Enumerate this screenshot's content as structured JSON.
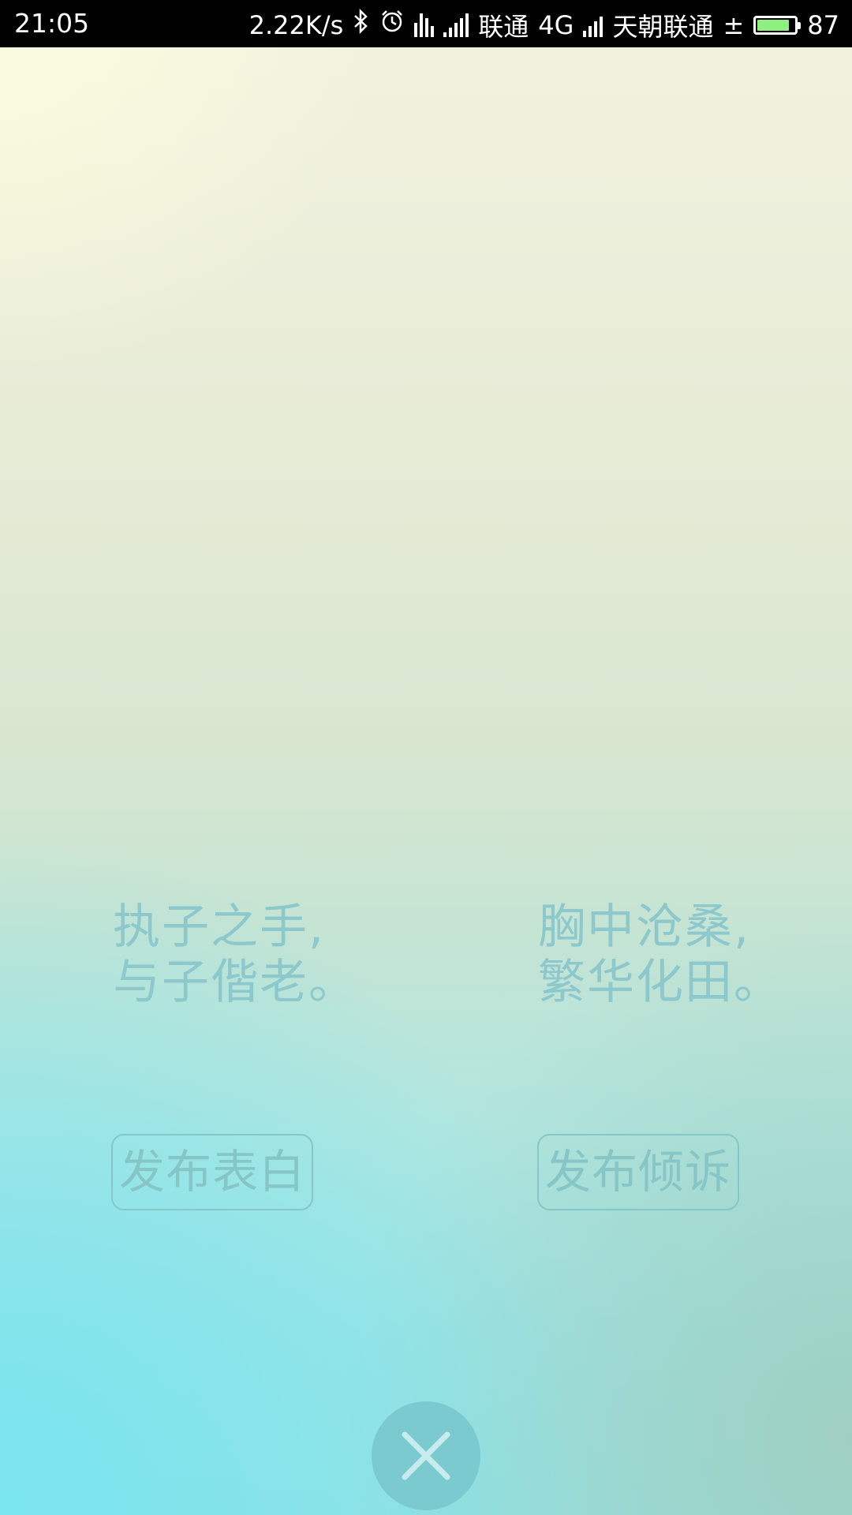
{
  "status_bar": {
    "time": "21:05",
    "net_speed": "2.22K/s",
    "carrier1": "联通",
    "network_type": "4G",
    "carrier2": "天朝联通",
    "charging_symbol": "±",
    "battery_level": 87,
    "battery_text": "87",
    "battery_color": "#8ef07f",
    "icons": [
      "bluetooth-icon",
      "alarm-icon",
      "vibrate-icon",
      "signal-icon",
      "signal-icon"
    ]
  },
  "main": {
    "poem_left": {
      "line1": "执子之手,",
      "line2": "与子偕老。"
    },
    "poem_right": {
      "line1": "胸中沧桑,",
      "line2": "繁华化田。"
    },
    "buttons": {
      "confess_label": "发布表白",
      "vent_label": "发布倾诉"
    },
    "close_icon": "close-icon"
  },
  "colors": {
    "text_accent": "#8cc8cc",
    "close_circle": "#76c4ca"
  }
}
